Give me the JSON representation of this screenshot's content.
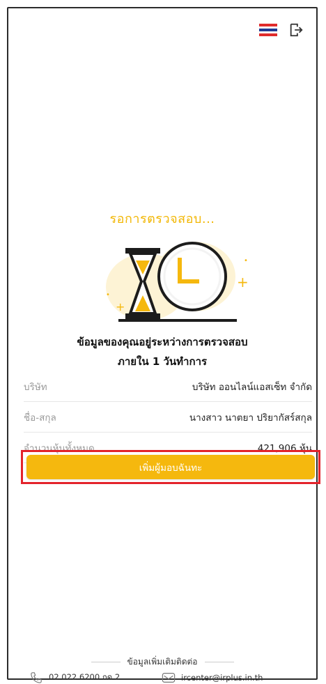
{
  "header": {
    "language_icon": "thai-flag-icon",
    "logout_icon": "logout-icon"
  },
  "status": {
    "title": "รอการตรวจสอบ...",
    "message_line1": "ข้อมูลของคุณอยู่ระหว่างการตรวจสอบ",
    "message_line2": "ภายใน 1 วันทำการ"
  },
  "details": [
    {
      "label": "บริษัท",
      "value": "บริษัท ออนไลน์แอสเซ็ท จำกัด"
    },
    {
      "label": "ชื่อ-สกุล",
      "value": "นางสาว นาตยา ปริยากัสร์สกุล"
    },
    {
      "label": "จำนวนหุ้นทั้งหมด",
      "value": "421,906 หุ้น"
    }
  ],
  "cta": {
    "label": "เพิ่มผู้มอบฉันทะ"
  },
  "footer": {
    "title": "ข้อมูลเพิ่มเติมติดต่อ",
    "phone": "02 022 6200 กด 2",
    "email": "ircenter@irplus.in.th"
  },
  "colors": {
    "accent": "#f5b80e",
    "title_yellow": "#f2b705",
    "highlight_red": "#e3232b"
  }
}
